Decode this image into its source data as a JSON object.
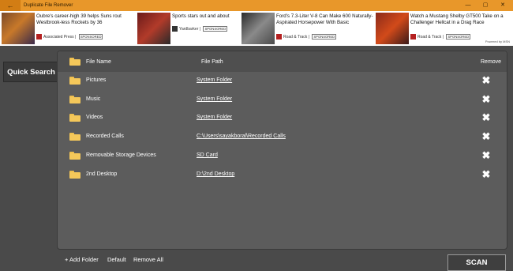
{
  "window": {
    "title": "Duplicate File Remover",
    "back_glyph": "←",
    "controls": {
      "minimize": "—",
      "maximize": "▢",
      "close": "✕"
    }
  },
  "ads": [
    {
      "headline": "Oubre's career-high 39 helps Suns rout Westbrook-less Rockets by 36",
      "source": "Associated Press",
      "sponsored": "SPONSORED"
    },
    {
      "headline": "Sports stars out and about",
      "source": "Yardbarker",
      "sponsored": "SPONSORED"
    },
    {
      "headline": "Ford's 7.3-Liter V-8 Can Make 600 Naturally-Aspirated Horsepower With Basic",
      "source": "Road & Track",
      "sponsored": "SPONSORED"
    },
    {
      "headline": "Watch a Mustang Shelby GT500 Take on a Challenger Hellcat in a Drag Race",
      "source": "Road & Track",
      "sponsored": "SPONSORED"
    }
  ],
  "powered_by": "Powered by MSN",
  "nav": {
    "quick_search": "Quick Search"
  },
  "table": {
    "col_name": "File Name",
    "col_path": "File Path",
    "col_remove": "Remove",
    "rows": [
      {
        "name": "Pictures",
        "path": "System Folder"
      },
      {
        "name": "Music",
        "path": "System Folder"
      },
      {
        "name": "Videos",
        "path": "System Folder"
      },
      {
        "name": "Recorded Calls",
        "path": "C:\\Users\\sayakboral\\Recorded Calls"
      },
      {
        "name": "Removable Storage Devices",
        "path": "SD Card"
      },
      {
        "name": "2nd Desktop",
        "path": "D:\\2nd Desktop"
      }
    ],
    "remove_glyph": "✖"
  },
  "footer": {
    "add_folder": "+ Add Folder",
    "default": "Default",
    "remove_all": "Remove All",
    "scan": "SCAN"
  }
}
